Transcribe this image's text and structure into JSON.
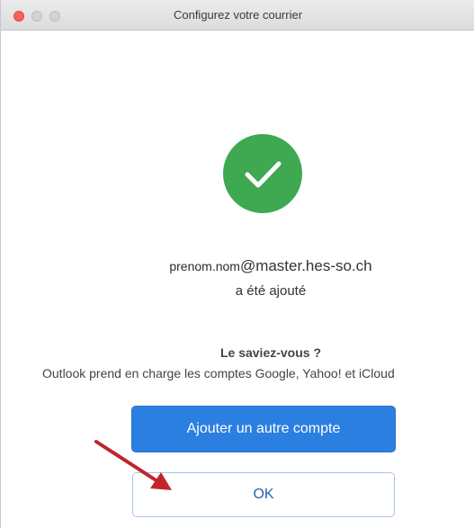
{
  "window": {
    "title": "Configurez votre courrier"
  },
  "status": {
    "icon": "check-icon",
    "icon_color": "#3ea950"
  },
  "account": {
    "email_local": "prenom.nom",
    "email_domain": "@master.hes-so.ch",
    "added_text": "a été ajouté"
  },
  "tip": {
    "heading": "Le saviez-vous ?",
    "body": "Outlook prend en charge les comptes Google, Yahoo! et iCloud"
  },
  "buttons": {
    "add_account_label": "Ajouter un autre compte",
    "add_account_color": "#2b7fe0",
    "ok_label": "OK"
  },
  "annotation": {
    "icon": "arrow-icon",
    "color": "#c0262b"
  }
}
